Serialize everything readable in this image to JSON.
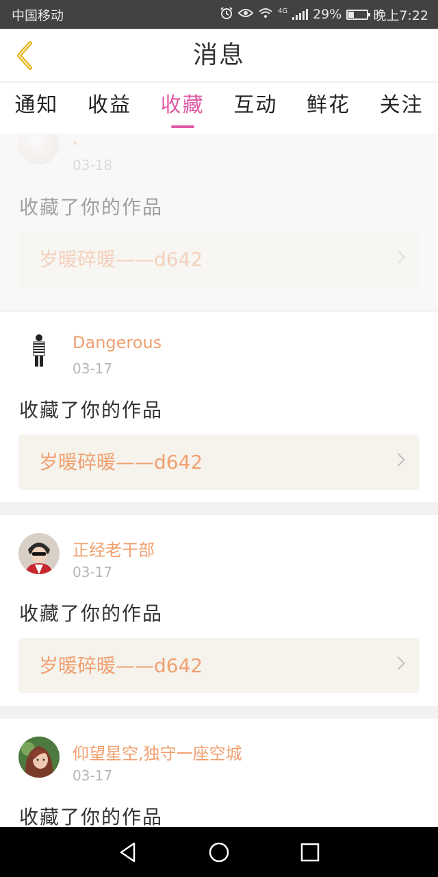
{
  "status_bar": {
    "carrier": "中国移动",
    "network": "4G",
    "battery": "29%",
    "battery_level": 0.29,
    "time": "晚上7:22",
    "icons": [
      "alarm-icon",
      "eye-icon",
      "wifi-icon",
      "signal-icon",
      "battery-icon"
    ]
  },
  "header": {
    "title": "消息",
    "back_icon": "chevron-left-icon",
    "back_color": "#e5b520"
  },
  "tabs": [
    {
      "label": "通知",
      "active": false
    },
    {
      "label": "收益",
      "active": false
    },
    {
      "label": "收藏",
      "active": true
    },
    {
      "label": "互动",
      "active": false
    },
    {
      "label": "鲜花",
      "active": false
    },
    {
      "label": "关注",
      "active": false
    }
  ],
  "colors": {
    "accent": "#e05aa4",
    "username": "#f0a070",
    "work_title": "#f0a070"
  },
  "notifications": [
    {
      "username": ",",
      "date": "03-18",
      "action": "收藏了你的作品",
      "work_title": "岁暖碎暖——d642"
    },
    {
      "username": "Dangerous",
      "date": "03-17",
      "action": "收藏了你的作品",
      "work_title": "岁暖碎暖——d642"
    },
    {
      "username": "正经老干部",
      "date": "03-17",
      "action": "收藏了你的作品",
      "work_title": "岁暖碎暖——d642"
    },
    {
      "username": "仰望星空,独守一座空城",
      "date": "03-17",
      "action": "收藏了你的作品"
    }
  ],
  "nav_bar": {
    "icons": [
      "back-triangle-icon",
      "home-circle-icon",
      "recents-square-icon"
    ]
  }
}
